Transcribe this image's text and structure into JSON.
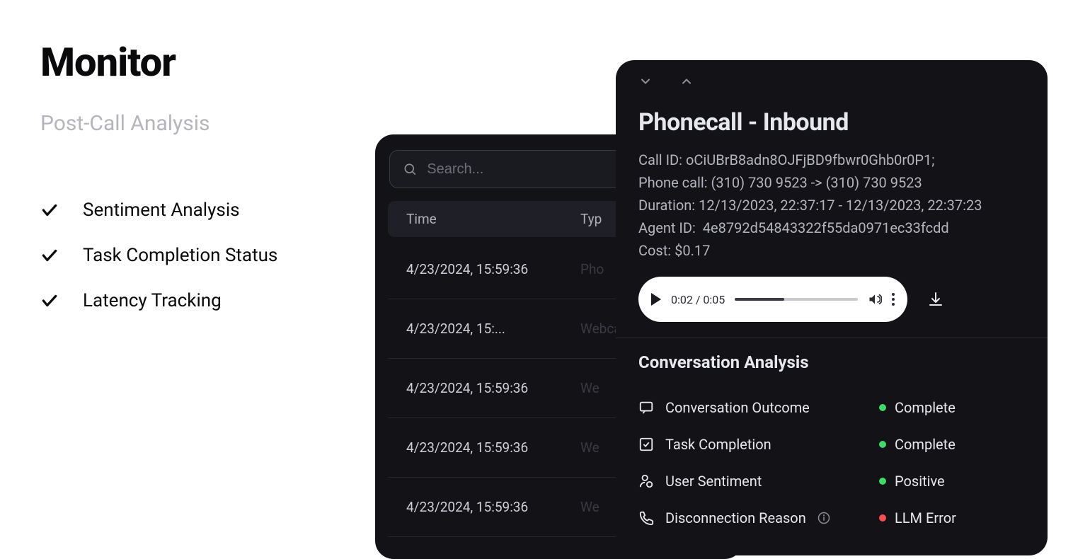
{
  "page": {
    "title": "Monitor",
    "subtitle": "Post-Call Analysis"
  },
  "features": [
    "Sentiment Analysis",
    "Task Completion Status",
    "Latency Tracking"
  ],
  "search": {
    "placeholder": "Search..."
  },
  "table": {
    "headers": {
      "time": "Time",
      "type": "Typ"
    },
    "rows": [
      {
        "time": "4/23/2024, 15:59:36",
        "type": "Pho"
      },
      {
        "time": "4/23/2024, 15:...",
        "type": "Webcall"
      },
      {
        "time": "4/23/2024, 15:59:36",
        "type": "We"
      },
      {
        "time": "4/23/2024, 15:59:36",
        "type": "We"
      },
      {
        "time": "4/23/2024, 15:59:36",
        "type": "We"
      }
    ]
  },
  "detail": {
    "title": "Phonecall - Inbound",
    "call_id_label": "Call ID:",
    "call_id": "oCiUBrB8adn8OJFjBD9fbwr0Ghb0r0P1;",
    "phone_label": "Phone call:",
    "phone": "(310) 730 9523 -> (310) 730 9523",
    "duration_label": "Duration:",
    "duration": "12/13/2023, 22:37:17 - 12/13/2023, 22:37:23",
    "agent_label": "Agent ID:",
    "agent": "4e8792d54843322f55da0971ec33fcdd",
    "cost_label": "Cost:",
    "cost": "$0.17",
    "audio": {
      "current": "0:02",
      "total": "0:05"
    },
    "analysis_heading": "Conversation Analysis",
    "rows": [
      {
        "icon": "chat",
        "label": "Conversation Outcome",
        "status": "Complete",
        "dot": "green",
        "info": false
      },
      {
        "icon": "check-square",
        "label": "Task Completion",
        "status": "Complete",
        "dot": "green",
        "info": false
      },
      {
        "icon": "user",
        "label": "User Sentiment",
        "status": "Positive",
        "dot": "green",
        "info": false
      },
      {
        "icon": "phone",
        "label": "Disconnection Reason",
        "status": "LLM Error",
        "dot": "red",
        "info": true
      }
    ]
  }
}
